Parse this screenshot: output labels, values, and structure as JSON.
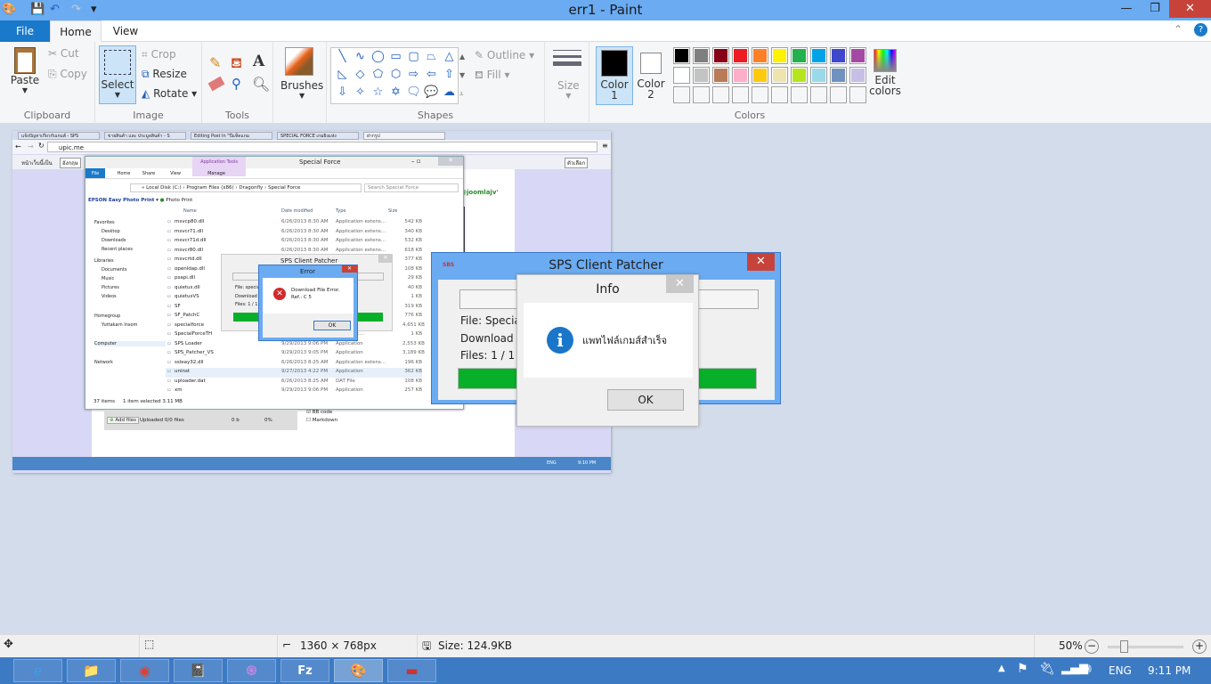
{
  "window": {
    "title": "err1 - Paint",
    "qa_icons": [
      "paint-app-icon",
      "save-icon",
      "undo-icon",
      "redo-icon",
      "customize-icon"
    ],
    "minimize": "—",
    "maximize": "❐",
    "close": "✕"
  },
  "tabs": {
    "file": "File",
    "home": "Home",
    "view": "View"
  },
  "ribbon": {
    "clipboard": {
      "label": "Clipboard",
      "paste": "Paste",
      "cut": "Cut",
      "copy": "Copy"
    },
    "image": {
      "label": "Image",
      "select": "Select",
      "crop": "Crop",
      "resize": "Resize",
      "rotate": "Rotate"
    },
    "tools": {
      "label": "Tools"
    },
    "brushes": "Brushes",
    "shapes": {
      "label": "Shapes",
      "outline": "Outline",
      "fill": "Fill",
      "glyphs": [
        "╲",
        "∿",
        "◯",
        "▭",
        "▢",
        "⏢",
        "△",
        "◺",
        "◇",
        "⬠",
        "⬡",
        "⇨",
        "⇦",
        "⇧",
        "⇩",
        "✧",
        "☆",
        "✡",
        "🗨",
        "💬",
        "☁"
      ]
    },
    "size": "Size",
    "colors": {
      "label": "Colors",
      "color1": "Color 1",
      "color2": "Color 2",
      "edit": "Edit colors",
      "color1_value": "#000000",
      "color2_value": "#ffffff",
      "palette": [
        "#000000",
        "#7f7f7f",
        "#880015",
        "#ed1c24",
        "#ff7f27",
        "#fff200",
        "#22b14c",
        "#00a2e8",
        "#3f48cc",
        "#a349a4",
        "#ffffff",
        "#c3c3c3",
        "#b97a57",
        "#ffaec9",
        "#ffc90e",
        "#efe4b0",
        "#b5e61d",
        "#99d9ea",
        "#7092be",
        "#c8bfe7"
      ]
    }
  },
  "screenshot": {
    "browser_tabs": [
      "แจ้งปัญหาเกี่ยวกับเกมส์ - SPS",
      "ขายสินค้า และ ประมูลสินค้า - S",
      "Editing Post In \"ปีแท็ดแกม",
      "SPECIAL FORCE เกมยิงแห่ง",
      "ฝากรูป"
    ],
    "url": "upic.me",
    "translate": "หน้าเว็บนี้เป็น",
    "translate_lang": "อังกฤษ",
    "translate_opt": "ตัวเลือก",
    "site_text": "@joomlajv'",
    "explorer": {
      "title": "Special Force",
      "context_tab": "Application Tools",
      "ribbon_tabs": [
        "File",
        "Home",
        "Share",
        "View",
        "Manage"
      ],
      "path": [
        "Local Disk (C:)",
        "Program Files (x86)",
        "Dragonfly",
        "Special Force"
      ],
      "search": "Search Special Force",
      "toolbar": "EPSON Easy Photo Print",
      "toolbar2": "Photo Print",
      "nav": [
        "Favorites",
        "Desktop",
        "Downloads",
        "Recent places",
        "Libraries",
        "Documents",
        "Music",
        "Pictures",
        "Videos",
        "Homegroup",
        "Yuttakarn Insom",
        "Computer",
        "Network"
      ],
      "columns": [
        "Name",
        "Date modified",
        "Type",
        "Size"
      ],
      "files": [
        [
          "msvcp80.dll",
          "6/26/2013 8:30 AM",
          "Application extens...",
          "542 KB"
        ],
        [
          "msvcr71.dll",
          "6/26/2013 8:30 AM",
          "Application extens...",
          "340 KB"
        ],
        [
          "msvcr71d.dll",
          "6/26/2013 8:30 AM",
          "Application extens...",
          "532 KB"
        ],
        [
          "msvcr80.dll",
          "6/26/2013 8:30 AM",
          "Application extens...",
          "618 KB"
        ],
        [
          "msvcrtd.dll",
          "",
          "",
          "377 KB"
        ],
        [
          "openldap.dll",
          "",
          "",
          "108 KB"
        ],
        [
          "psapi.dll",
          "",
          "",
          "29 KB"
        ],
        [
          "quietus.dll",
          "",
          "",
          "40 KB"
        ],
        [
          "quietusVS",
          "",
          "",
          "1 KB"
        ],
        [
          "SF",
          "",
          "",
          "319 KB"
        ],
        [
          "SF_PatchC",
          "",
          "",
          "776 KB"
        ],
        [
          "specialforce",
          "",
          "",
          "4,651 KB"
        ],
        [
          "SpecialForceTH",
          "",
          "ation sett...",
          "1 KB"
        ],
        [
          "SPS Loader",
          "9/29/2013 9:06 PM",
          "Application",
          "2,553 KB"
        ],
        [
          "SPS_Patcher_VS",
          "9/29/2013 9:05 PM",
          "Application",
          "3,189 KB"
        ],
        [
          "ssleay32.dll",
          "6/26/2013 8:25 AM",
          "Application extens...",
          "196 KB"
        ],
        [
          "uninst",
          "9/27/2013 4:22 PM",
          "Application",
          "362 KB"
        ],
        [
          "uploader.dat",
          "6/26/2013 8:25 AM",
          "DAT File",
          "108 KB"
        ],
        [
          "xm",
          "9/29/2013 9:06 PM",
          "Application",
          "257 KB"
        ]
      ],
      "status": "37 items",
      "selected": "1 item selected  3.11 MB"
    },
    "small_patcher": {
      "title": "SPS Client Patcher",
      "file": "File: specia",
      "download": "Download /",
      "files": "Files: 1 / 1"
    },
    "error": {
      "title": "Error",
      "line1": "Download File Error.",
      "line2": "Ref.: C 5",
      "ok": "OK"
    },
    "upload": {
      "add": "Add files",
      "uploaded": "Uploaded 0/0 files",
      "bytes": "0 b",
      "pct": "0%",
      "bbcode": "BB code",
      "markdown": "Markdown"
    },
    "taskbar_clock": "9:10 PM",
    "taskbar_lang": "ENG"
  },
  "patcher": {
    "title": "SPS Client Patcher",
    "logo": "SBS",
    "file": "File: SpecialF",
    "download": "Download / S",
    "files": "Files: 1 / 1",
    "progress_pct": 100,
    "close": "✕"
  },
  "info": {
    "title": "Info",
    "message": "แพทไฟล์เกมส์สำเร็จ",
    "ok": "OK",
    "close": "✕"
  },
  "status": {
    "dimensions": "1360 × 768px",
    "size": "Size: 124.9KB",
    "zoom": "50%",
    "zoom_pct": 50
  },
  "taskbar": {
    "apps": [
      "internet-explorer",
      "file-explorer",
      "chrome",
      "notepad",
      "app-swirl",
      "filezilla",
      "paint",
      "sps-patcher"
    ],
    "lang": "ENG",
    "clock": "9:11 PM"
  }
}
